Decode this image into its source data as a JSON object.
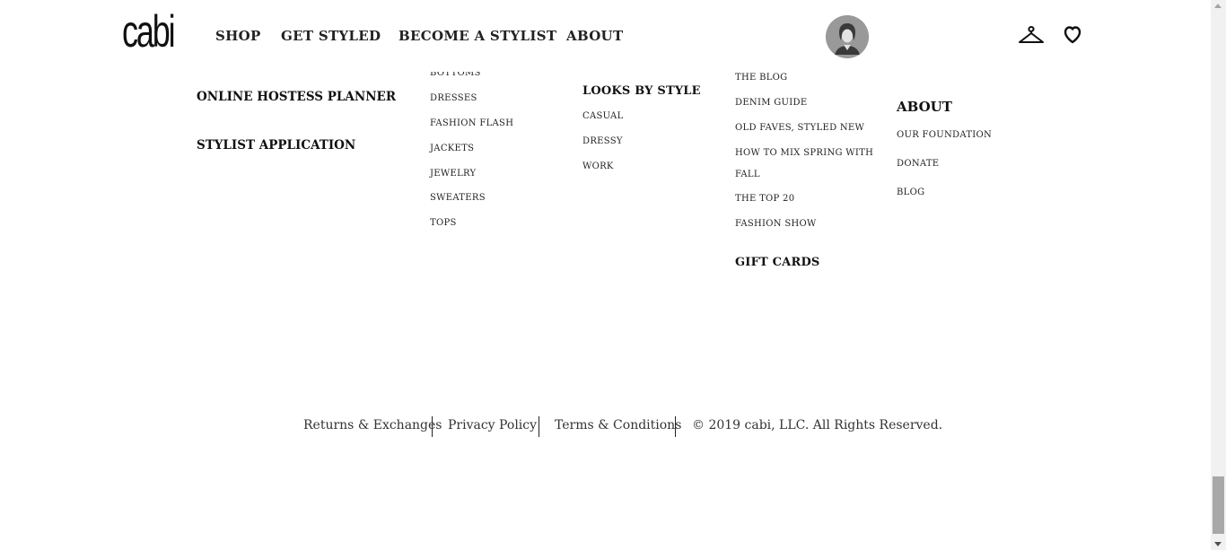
{
  "header": {
    "logo": "cabi",
    "nav": [
      "SHOP",
      "GET STYLED",
      "BECOME A STYLIST",
      "ABOUT"
    ],
    "avatar_icon": "user-avatar-icon",
    "hanger_icon": "hanger-icon",
    "heart_icon": "heart-icon"
  },
  "columns": {
    "col1": {
      "links": [
        "ONLINE HOSTESS PLANNER",
        "STYLIST APPLICATION"
      ]
    },
    "col2": {
      "links": [
        "BOTTOMS",
        "DRESSES",
        "FASHION FLASH",
        "JACKETS",
        "JEWELRY",
        "SWEATERS",
        "TOPS"
      ]
    },
    "col3": {
      "heading": "LOOKS BY STYLE",
      "links": [
        "CASUAL",
        "DRESSY",
        "WORK"
      ]
    },
    "col4": {
      "links": [
        "THE BLOG",
        "DENIM GUIDE",
        "OLD FAVES, STYLED NEW",
        "HOW TO MIX SPRING WITH",
        "FALL",
        "THE TOP 20",
        "FASHION SHOW"
      ],
      "heading2": "GIFT CARDS"
    },
    "col5": {
      "heading": "ABOUT",
      "links": [
        "OUR FOUNDATION",
        "DONATE",
        "BLOG"
      ]
    }
  },
  "footer": {
    "returns": "Returns & Exchanges",
    "privacy": "Privacy Policy",
    "terms": "Terms & Conditions",
    "copyright": "© 2019 cabi, LLC. All Rights Reserved."
  }
}
